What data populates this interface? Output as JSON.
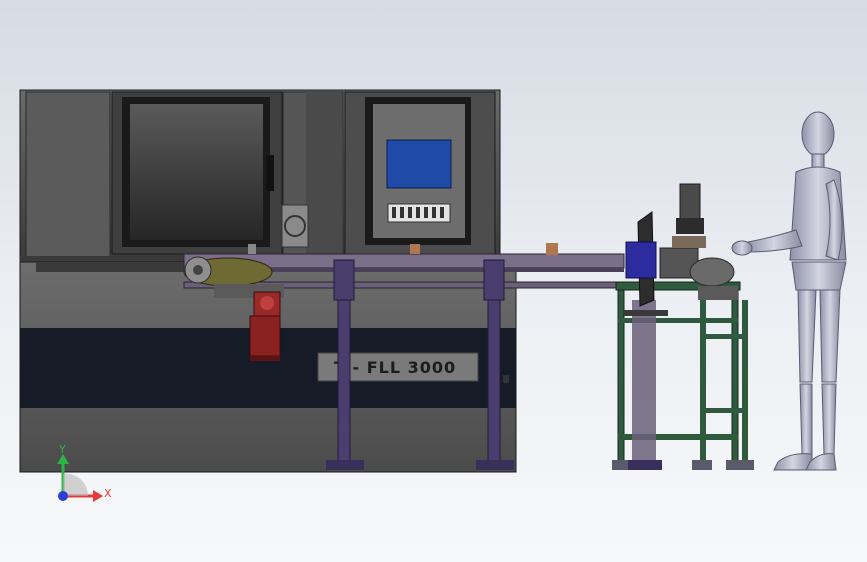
{
  "machine": {
    "brand_label": "T - FLL 3000"
  },
  "axes": {
    "x_label": "X",
    "y_label": "Y",
    "x_color": "#e23a3a",
    "y_color": "#2fb44a",
    "z_color": "#2b3fd6"
  },
  "colors": {
    "cabinet": "#4a4a4a",
    "cabinet_dark": "#2b2b2b",
    "base_stripe": "#1b2230",
    "rail": "#5c4d6a",
    "legs": "#4a3e6e",
    "table_frame": "#2f5a3e",
    "screen": "#1f4aa8",
    "motor": "#9a2a2a",
    "human": "#b7b9c9"
  }
}
